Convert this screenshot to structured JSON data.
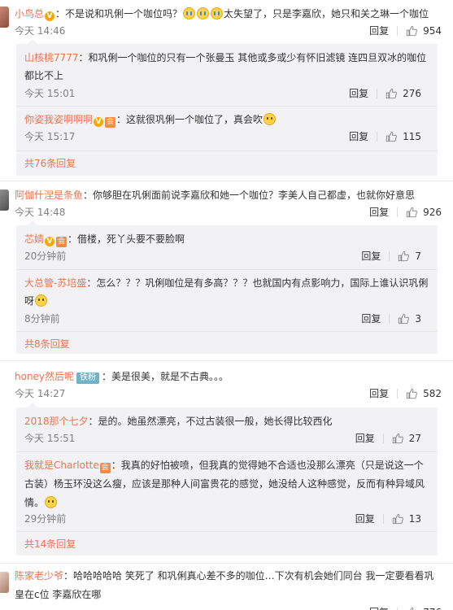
{
  "comments": [
    {
      "user": "小鸟总",
      "text_before": "：不是说和巩俐一个咖位吗？",
      "text_after": "太失望了，只是李嘉欣，她只和关之琳一个咖位",
      "time": "今天 14:46",
      "reply_label": "回复",
      "likes": "954",
      "replies": [
        {
          "user": "山核桃7777",
          "text": "：和巩俐一个咖位的只有一个张曼玉  其他或多或少有怀旧滤镜 连四旦双冰的咖位",
          "text2": "都比不上",
          "time": "今天 15:01",
          "reply_label": "回复",
          "likes": "276"
        },
        {
          "user": "你姿我姿啊啊啊",
          "text": "：这就很巩俐一个咖位了，真会吹",
          "time": "今天 15:17",
          "reply_label": "回复",
          "likes": "115"
        }
      ],
      "more": "共76条回复"
    },
    {
      "user": "阿伽什涅是条鱼",
      "text": "：你够胆在巩俐面前说李嘉欣和她一个咖位？李美人自己都虚，也就你好意思",
      "time": "今天 14:48",
      "reply_label": "回复",
      "likes": "926",
      "replies": [
        {
          "user": "芯婧",
          "text": "：借楼，死丫头要不要脸啊",
          "time": "20分钟前",
          "reply_label": "回复",
          "likes": "7"
        },
        {
          "user": "大总管-苏培盛",
          "text": "：怎么？？？巩俐咖位是有多高？？？也就国内有点影响力，国际上谁认识巩俐",
          "text2": "呀",
          "time": "8分钟前",
          "reply_label": "回复",
          "likes": "3"
        }
      ],
      "more": "共8条回复"
    },
    {
      "user": "honey然后呢",
      "badge": "铁粉",
      "text": "：美是很美，就是不古典。。。",
      "time": "今天 14:27",
      "reply_label": "回复",
      "likes": "582",
      "replies": [
        {
          "user": "2018那个七夕",
          "text": "：是的。她虽然漂亮，不过古装很一般，她长得比较西化",
          "time": "今天 15:51",
          "reply_label": "回复",
          "likes": "27"
        },
        {
          "user": "我就是Charlotte",
          "text": "：我真的好怕被喷，但我真的觉得她不合适也没那么漂亮（只是说这一个",
          "text2": "古装）杨玉环没这么瘦，应该是那种人间富贵花的感觉，她没给人这种感觉，反而有种异域风",
          "text3": "情。",
          "time": "29分钟前",
          "reply_label": "回复",
          "likes": "13"
        }
      ],
      "more": "共14条回复"
    },
    {
      "user": "陈家老少爷",
      "text": "：哈哈哈哈哈 笑死了 和巩俐真心差不多的咖位…下次有机会她们同台 我一定要看看巩",
      "text2": "皇在c位 李嘉欣在哪",
      "time": "",
      "reply_label": "回复",
      "likes": "776"
    }
  ],
  "colors": {
    "username": "#eb7350",
    "text": "#333333",
    "time": "#808080",
    "reply_bg": "#f2f2f5"
  }
}
